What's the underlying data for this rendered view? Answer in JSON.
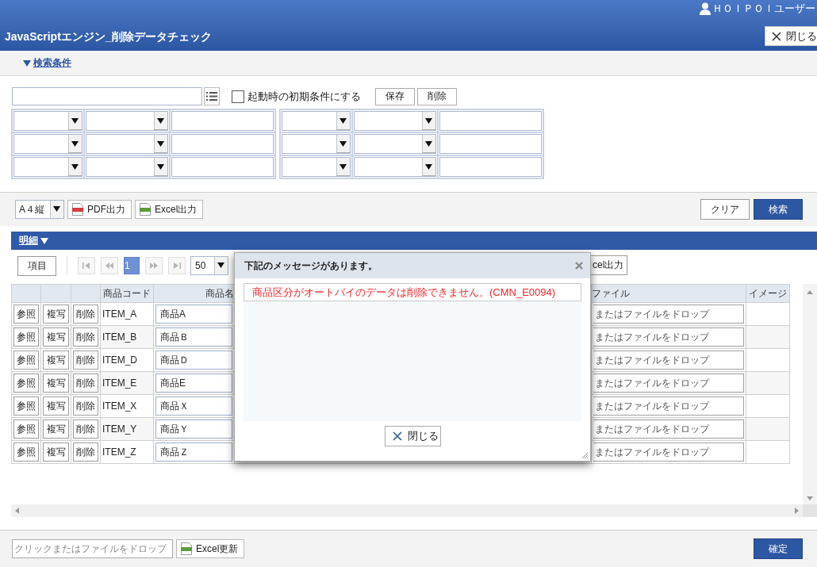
{
  "header": {
    "user": "ＨＯＩＰＯＩユーザー",
    "title": "JavaScriptエンジン_削除データチェック",
    "close_button": "閉じる"
  },
  "search_toggle": {
    "label": "検索条件",
    "expanded": true
  },
  "search": {
    "default_checkbox": {
      "label": "起動時の初期条件にする",
      "checked": false
    },
    "buttons": [
      "保存",
      "削除"
    ],
    "condition_groups": [
      {
        "rows": [
          {
            "fields": [
              {
                "kind": "select"
              },
              {
                "kind": "select"
              },
              {
                "kind": "text"
              }
            ]
          },
          {
            "fields": [
              {
                "kind": "select"
              },
              {
                "kind": "select"
              },
              {
                "kind": "text"
              }
            ]
          },
          {
            "fields": [
              {
                "kind": "select"
              },
              {
                "kind": "select"
              },
              {
                "kind": "text"
              }
            ]
          }
        ]
      },
      {
        "rows": [
          {
            "fields": [
              {
                "kind": "select"
              },
              {
                "kind": "select"
              },
              {
                "kind": "text"
              }
            ]
          },
          {
            "fields": [
              {
                "kind": "select"
              },
              {
                "kind": "select"
              },
              {
                "kind": "text"
              }
            ]
          },
          {
            "fields": [
              {
                "kind": "select"
              },
              {
                "kind": "select"
              },
              {
                "kind": "text"
              }
            ]
          }
        ]
      }
    ]
  },
  "toolbar": {
    "paper_size": "A４縦",
    "export_buttons": [
      {
        "kind": "pdf",
        "label": "PDF出力"
      },
      {
        "kind": "excel",
        "label": "Excel出力"
      }
    ],
    "actions": [
      {
        "kind": "plain",
        "label": "クリア"
      },
      {
        "kind": "primary",
        "label": "検索"
      }
    ]
  },
  "detail": {
    "title": "明細",
    "expanded": true,
    "items_button": "項目",
    "pager": {
      "nav_before": [
        {
          "kind": "first",
          "disabled": true
        },
        {
          "kind": "prev",
          "disabled": true
        }
      ],
      "pages": [
        {
          "label": "1",
          "selected": true
        }
      ],
      "nav_after": [
        {
          "kind": "next",
          "disabled": true
        },
        {
          "kind": "last",
          "disabled": true
        }
      ],
      "page_size": "50"
    },
    "export_button": "cel出力",
    "table": {
      "columns": [
        "商品コード",
        "商品名",
        "ファイル",
        "イメージ"
      ],
      "rows": [
        {
          "actions": [
            "参照",
            "複写",
            "削除"
          ],
          "code": "ITEM_A",
          "name": "商品A",
          "file": "またはファイルをドロップ"
        },
        {
          "actions": [
            "参照",
            "複写",
            "削除"
          ],
          "code": "ITEM_B",
          "name": "商品Ｂ",
          "file": "またはファイルをドロップ"
        },
        {
          "actions": [
            "参照",
            "複写",
            "削除"
          ],
          "code": "ITEM_D",
          "name": "商品Ｄ",
          "file": "またはファイルをドロップ"
        },
        {
          "actions": [
            "参照",
            "複写",
            "削除"
          ],
          "code": "ITEM_E",
          "name": "商品E",
          "file": "またはファイルをドロップ"
        },
        {
          "actions": [
            "参照",
            "複写",
            "削除"
          ],
          "code": "ITEM_X",
          "name": "商品Ｘ",
          "file": "またはファイルをドロップ"
        },
        {
          "actions": [
            "参照",
            "複写",
            "削除"
          ],
          "code": "ITEM_Y",
          "name": "商品Ｙ",
          "file": "またはファイルをドロップ"
        },
        {
          "actions": [
            "参照",
            "複写",
            "削除"
          ],
          "code": "ITEM_Z",
          "name": "商品Ｚ",
          "file": "またはファイルをドロップ"
        }
      ]
    }
  },
  "dialog": {
    "title": "下記のメッセージがあります。",
    "messages": [
      {
        "kind": "error",
        "text": "商品区分がオートバイのデータは削除できません。(CMN_E0094)"
      }
    ],
    "close_button": "閉じる"
  },
  "footer": {
    "drop_zone": "クリックまたはファイルをドロップ",
    "buttons": [
      {
        "kind": "excel",
        "label": "Excel更新"
      }
    ],
    "confirm_button": "確定"
  }
}
